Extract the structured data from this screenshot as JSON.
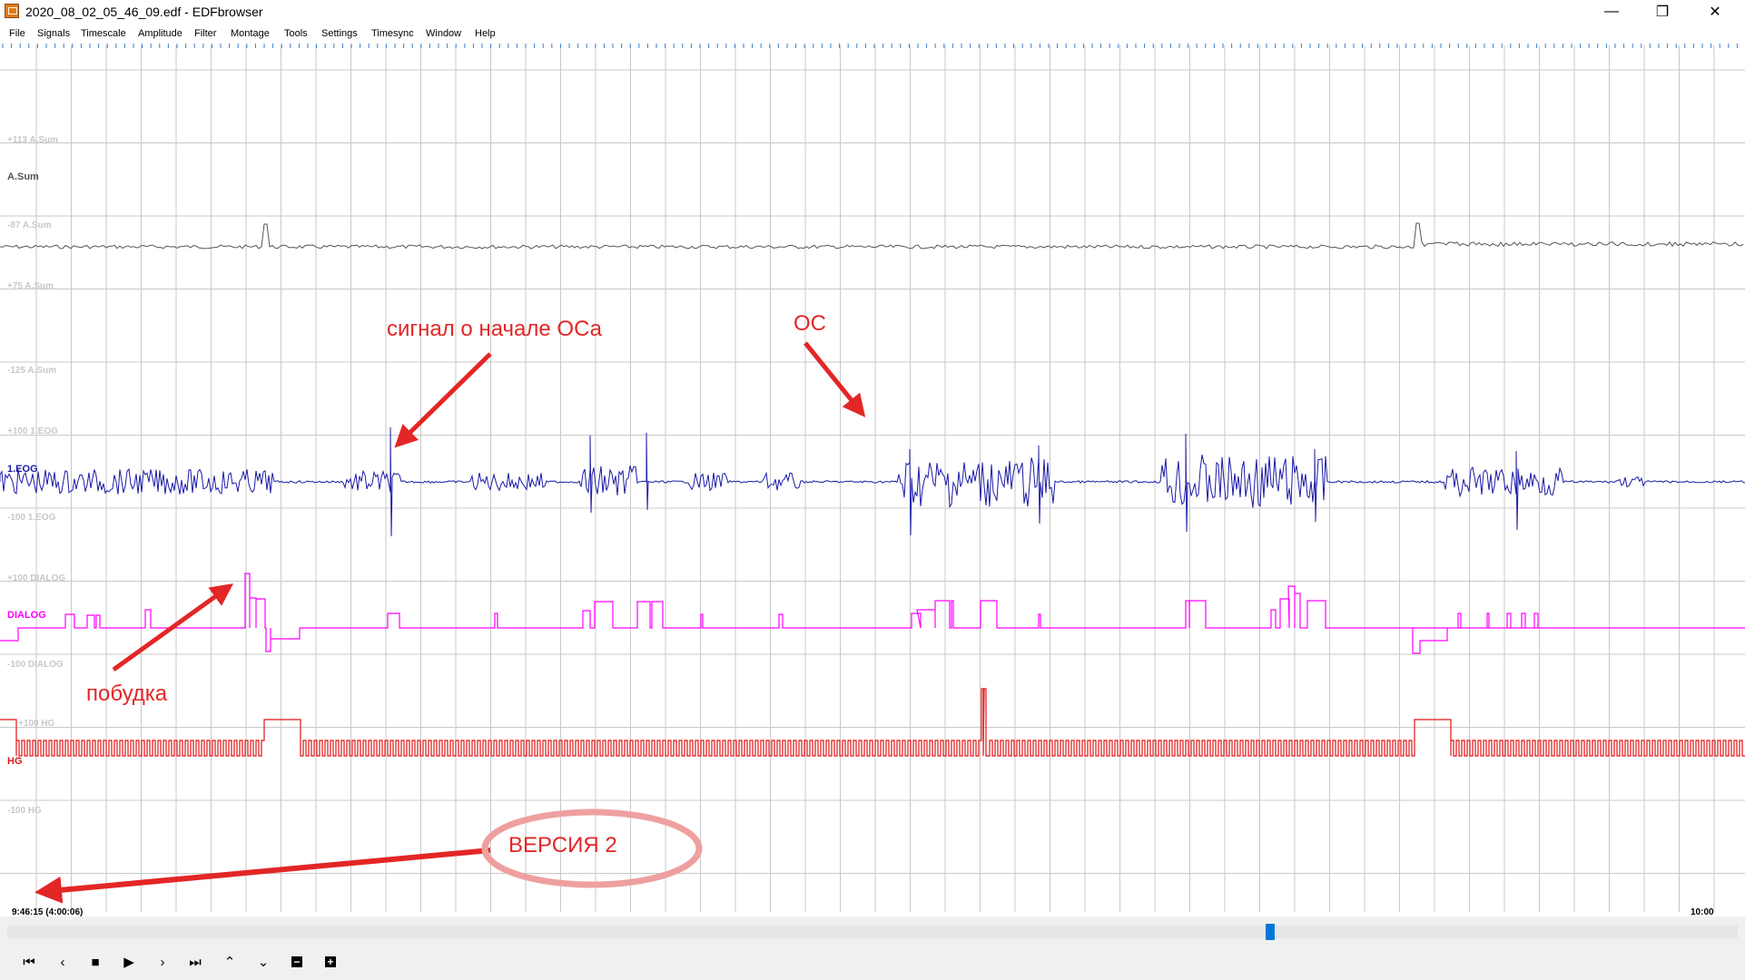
{
  "window": {
    "title": "2020_08_02_05_46_09.edf - EDFbrowser",
    "controls": {
      "minimize": "—",
      "maximize": "❐",
      "close": "✕"
    }
  },
  "menu": [
    "File",
    "Signals",
    "Timescale",
    "Amplitude",
    "Filter",
    "Montage",
    "Tools",
    "Settings",
    "Timesync",
    "Window",
    "Help"
  ],
  "signals": {
    "asum": {
      "name": "A.Sum",
      "top": "+113 A.Sum",
      "upper": "-87 A.Sum",
      "lower": "+75 A.Sum",
      "bottom": "-125 A.Sum",
      "color": "#555555"
    },
    "eog": {
      "name": "1.EOG",
      "top": "+100 1.EOG",
      "bottom": "-100 1.EOG",
      "color": "#1a1aa6"
    },
    "dialog": {
      "name": "DIALOG",
      "top": "+100 DIALOG",
      "bottom": "-100 DIALOG",
      "color": "#ff00ff"
    },
    "hg": {
      "name": "HG",
      "top": "+100 HG",
      "bottom": "-100 HG",
      "color": "#e01515"
    }
  },
  "annotations": {
    "signal_start": "сигнал о начале ОСа",
    "os": "ОС",
    "wakeup": "побудка",
    "version": "ВЕРСИЯ 2"
  },
  "timebar": {
    "start": "9:46:15 (4:00:06)",
    "end": "10:00"
  },
  "controls": [
    "first-icon",
    "prev-icon",
    "stop-icon",
    "play-icon",
    "next-icon",
    "last-icon",
    "amp-up-icon",
    "amp-down-icon",
    "zoom-out-icon",
    "zoom-in-icon"
  ],
  "colors": {
    "grid": "#c8c8c8",
    "anno": "#e32626",
    "scroll_thumb": "#0078d7"
  }
}
